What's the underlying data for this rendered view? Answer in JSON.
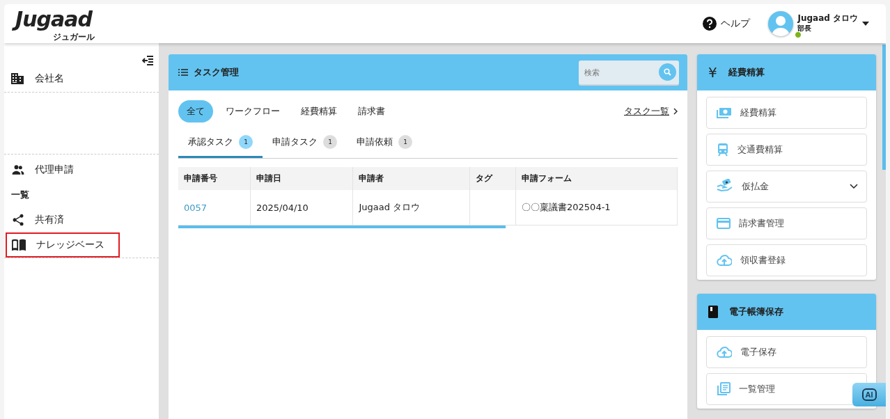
{
  "header": {
    "logo": "Jugaad",
    "logo_sub": "ジュガール",
    "help": "ヘルプ",
    "user": {
      "name": "Jugaad タロウ",
      "role": "部長",
      "online": true
    }
  },
  "sidebar": {
    "company": "会社名",
    "items": [
      {
        "kind": "item",
        "label": "代理申請",
        "highlighted": false
      },
      {
        "kind": "heading",
        "label": "一覧"
      },
      {
        "kind": "item",
        "label": "共有済",
        "highlighted": false
      },
      {
        "kind": "item",
        "label": "ナレッジベース",
        "highlighted": true
      }
    ]
  },
  "task_panel": {
    "title": "タスク管理",
    "search": {
      "placeholder": "検索"
    },
    "filters": [
      {
        "label": "全て",
        "selected": true
      },
      {
        "label": "ワークフロー",
        "selected": false
      },
      {
        "label": "経費精算",
        "selected": false
      },
      {
        "label": "請求書",
        "selected": false
      }
    ],
    "link": "タスク一覧",
    "tabs": [
      {
        "label": "承認タスク",
        "count": "1",
        "selected": true
      },
      {
        "label": "申請タスク",
        "count": "1",
        "selected": false
      },
      {
        "label": "申請依頼",
        "count": "1",
        "selected": false
      }
    ],
    "table": {
      "columns": [
        "申請番号",
        "申請日",
        "申請者",
        "タグ",
        "申請フォーム"
      ],
      "rows": [
        {
          "cells": [
            "0057",
            "2025/04/10",
            "Jugaad タロウ",
            "",
            "〇〇稟議書202504-1"
          ]
        }
      ]
    }
  },
  "cards": [
    {
      "title": "経費精算",
      "icon": "¥",
      "items": [
        {
          "label": "経費精算",
          "expandable": false
        },
        {
          "label": "交通費精算",
          "expandable": false
        },
        {
          "label": "仮払金",
          "expandable": true
        },
        {
          "label": "請求書管理",
          "expandable": false
        },
        {
          "label": "領収書登録",
          "expandable": false
        }
      ]
    },
    {
      "title": "電子帳簿保存",
      "items": [
        {
          "label": "電子保存",
          "expandable": false
        },
        {
          "label": "一覧管理",
          "expandable": false
        }
      ]
    }
  ],
  "ai_button": "AI"
}
